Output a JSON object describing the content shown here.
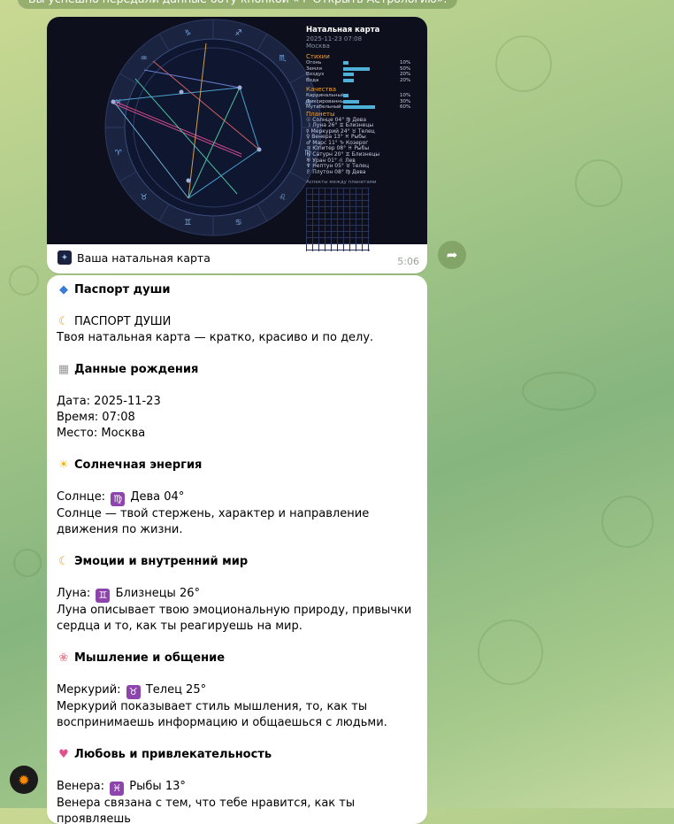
{
  "top_notice": "Вы успешно передали данные боту кнопкой «♈ Открыть Астрологию».",
  "photo": {
    "chart_title": "Натальная карта",
    "chart_datetime": "2025-11-23 07:08",
    "chart_city": "Москва",
    "elements_title": "Стихии",
    "elements": [
      {
        "name": "Огонь",
        "value": "10%",
        "fraction": 0.1
      },
      {
        "name": "Земля",
        "value": "50%",
        "fraction": 0.5
      },
      {
        "name": "Воздух",
        "value": "20%",
        "fraction": 0.2
      },
      {
        "name": "Вода",
        "value": "20%",
        "fraction": 0.2
      }
    ],
    "qualities_title": "Качества",
    "qualities": [
      {
        "name": "Кардинальный",
        "value": "10%",
        "fraction": 0.1
      },
      {
        "name": "Фиксированный",
        "value": "30%",
        "fraction": 0.3
      },
      {
        "name": "Мутабельный",
        "value": "60%",
        "fraction": 0.6
      }
    ],
    "planets_title": "Планеты",
    "planets": [
      "☉ Солнце 04° ♍ Дева",
      "☽ Луна 26° ♊ Близнецы",
      "☿ Меркурий 24° ♉ Телец",
      "♀ Венера 13° ♓ Рыбы",
      "♂ Марс 11° ♑ Козерог",
      "♃ Юпитер 08° ♓ Рыбы",
      "♄ Сатурн 20° ♊ Близнецы",
      "♅ Уран 01° ♌ Лев",
      "♆ Нептун 05° ♉ Телец",
      "♇ Плутон 08° ♍ Дева"
    ],
    "aspects_title": "Аспекты между планетами",
    "wheel_signs": [
      "♈",
      "♉",
      "♊",
      "♋",
      "♌",
      "♍",
      "♎",
      "♏",
      "♐",
      "♑",
      "♒",
      "♓"
    ],
    "caption": "Ваша натальная карта",
    "time": "5:06"
  },
  "message": {
    "header": "Паспорт души",
    "title_line": "ПАСПОРТ ДУШИ",
    "intro": "Твоя натальная карта — кратко, красиво и по делу.",
    "birth": {
      "heading": "Данные рождения",
      "date": "Дата: 2025-11-23",
      "time": "Время: 07:08",
      "place": "Место: Москва"
    },
    "sun": {
      "heading": "Солнечная энергия",
      "label": "Солнце:",
      "sign": "♍",
      "position": "Дева 04°",
      "text": "Солнце — твой стержень, характер и направление движения по жизни."
    },
    "moon": {
      "heading": "Эмоции и внутренний мир",
      "label": "Луна:",
      "sign": "♊",
      "position": "Близнецы 26°",
      "text": "Луна описывает твою эмоциональную природу, привычки сердца и то, как ты реагируешь на мир."
    },
    "mercury": {
      "heading": "Мышление и общение",
      "label": "Меркурий:",
      "sign": "♉",
      "position": "Телец 25°",
      "text": "Меркурий показывает стиль мышления, то, как ты воспринимаешь информацию и общаешься с людьми."
    },
    "venus": {
      "heading": "Любовь и привлекательность",
      "label": "Венера:",
      "sign": "♓",
      "position": "Рыбы 13°",
      "text": "Венера связана с тем, что тебе нравится, как ты проявляешь"
    }
  },
  "colors": {
    "accent": "#8e44ad",
    "bar": "#4fb0d8",
    "wheel_bg": "#1a2440",
    "header_orange": "#f0a030"
  }
}
